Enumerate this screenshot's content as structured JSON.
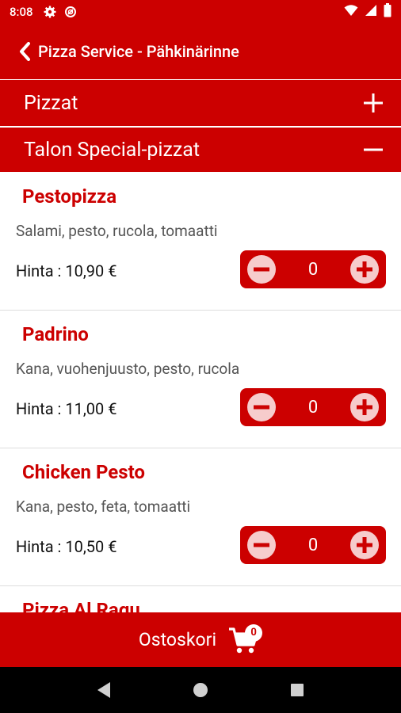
{
  "status_bar": {
    "time": "8:08",
    "icons": [
      "gear-icon",
      "data-saver-icon",
      "wifi-icon",
      "signal-icon",
      "battery-icon"
    ]
  },
  "app_bar": {
    "back_icon": "chevron-left-icon",
    "title": "Pizza Service - Pähkinärinne"
  },
  "categories": [
    {
      "label": "Pizzat",
      "toggle": "plus-icon"
    },
    {
      "label": "Talon Special-pizzat",
      "toggle": "minus-icon"
    }
  ],
  "items": [
    {
      "name": "Pestopizza",
      "description": "Salami, pesto, rucola, tomaatti",
      "price": "Hinta : 10,90 €",
      "quantity": "0"
    },
    {
      "name": "Padrino",
      "description": "Kana, vuohenjuusto, pesto, rucola",
      "price": "Hinta : 11,00 €",
      "quantity": "0"
    },
    {
      "name": "Chicken Pesto",
      "description": "Kana, pesto, feta, tomaatti",
      "price": "Hinta : 10,50 €",
      "quantity": "0"
    },
    {
      "name": "Pizza Al Ragu",
      "description": "",
      "price": "",
      "quantity": ""
    }
  ],
  "cart": {
    "label": "Ostoskori",
    "count": "0",
    "icon": "cart-icon"
  },
  "colors": {
    "primary": "#cc0000",
    "stepper_button_fill": "#f6cccc"
  }
}
